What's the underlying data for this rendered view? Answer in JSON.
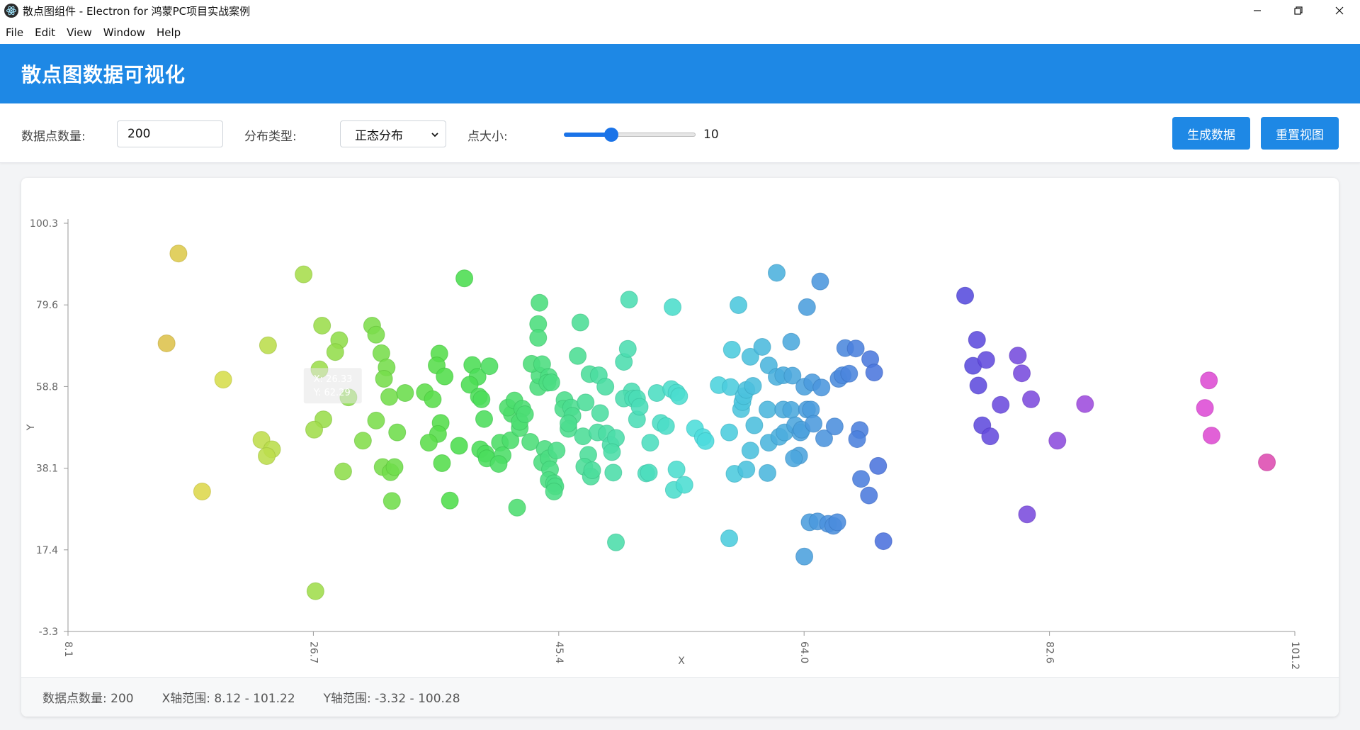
{
  "window": {
    "title": "散点图组件 - Electron for 鸿蒙PC项目实战案例"
  },
  "menu": [
    "File",
    "Edit",
    "View",
    "Window",
    "Help"
  ],
  "header": {
    "title": "散点图数据可视化"
  },
  "controls": {
    "count_label": "数据点数量:",
    "count_value": "200",
    "dist_label": "分布类型:",
    "dist_value": "正态分布",
    "size_label": "点大小:",
    "size_value": "10",
    "size_fraction": 0.36,
    "generate_button": "生成数据",
    "reset_button": "重置视图"
  },
  "stats": {
    "count": "数据点数量: 200",
    "x_range": "X轴范围: 8.12 - 101.22",
    "y_range": "Y轴范围: -3.32 - 100.28"
  },
  "tooltip": {
    "x": "X: 26.33",
    "y": "Y: 62.29"
  },
  "chart_data": {
    "type": "scatter",
    "xlabel": "X",
    "ylabel": "Y",
    "xlim": [
      8.12,
      101.22
    ],
    "ylim": [
      -3.32,
      100.28
    ],
    "xticks": [
      "8.1",
      "26.7",
      "45.4",
      "64.0",
      "82.6",
      "101.2"
    ],
    "xtick_values": [
      8.12,
      26.74,
      45.36,
      63.98,
      82.6,
      101.22
    ],
    "yticks": [
      "100.3",
      "79.6",
      "58.8",
      "38.1",
      "17.4",
      "-3.3"
    ],
    "ytick_values": [
      100.28,
      79.56,
      58.84,
      38.12,
      17.4,
      -3.32
    ],
    "grid": false,
    "point_color_scale": "hue by x: orange (low x) -> green -> cyan -> blue -> purple -> pink (high x)",
    "points": [
      [
        16.5,
        92.6
      ],
      [
        15.6,
        69.8
      ],
      [
        19.9,
        60.6
      ],
      [
        18.3,
        32.2
      ],
      [
        23.3,
        69.3
      ],
      [
        22.8,
        45.3
      ],
      [
        23.6,
        42.9
      ],
      [
        23.2,
        41.2
      ],
      [
        26.0,
        87.3
      ],
      [
        27.4,
        74.3
      ],
      [
        27.2,
        63.2
      ],
      [
        28.7,
        70.6
      ],
      [
        28.4,
        67.6
      ],
      [
        27.5,
        50.5
      ],
      [
        26.8,
        47.9
      ],
      [
        26.9,
        6.9
      ],
      [
        29.4,
        56.1
      ],
      [
        29.0,
        37.3
      ],
      [
        30.5,
        45.1
      ],
      [
        31.2,
        74.3
      ],
      [
        31.5,
        72.0
      ],
      [
        31.9,
        67.3
      ],
      [
        32.3,
        63.7
      ],
      [
        32.1,
        60.8
      ],
      [
        32.5,
        56.2
      ],
      [
        31.5,
        50.2
      ],
      [
        32.0,
        38.4
      ],
      [
        32.6,
        37.1
      ],
      [
        32.9,
        38.4
      ],
      [
        32.7,
        29.8
      ],
      [
        33.1,
        47.2
      ],
      [
        33.7,
        57.2
      ],
      [
        35.2,
        57.4
      ],
      [
        35.8,
        55.6
      ],
      [
        36.3,
        67.2
      ],
      [
        36.1,
        64.2
      ],
      [
        36.7,
        61.4
      ],
      [
        36.4,
        49.6
      ],
      [
        36.2,
        46.8
      ],
      [
        36.5,
        39.4
      ],
      [
        35.5,
        44.6
      ],
      [
        37.1,
        29.9
      ],
      [
        37.8,
        43.8
      ],
      [
        38.8,
        64.3
      ],
      [
        39.2,
        61.3
      ],
      [
        38.6,
        59.3
      ],
      [
        39.3,
        56.3
      ],
      [
        39.5,
        55.6
      ],
      [
        39.7,
        50.6
      ],
      [
        39.4,
        42.9
      ],
      [
        39.8,
        41.8
      ],
      [
        39.9,
        40.6
      ],
      [
        38.2,
        86.3
      ],
      [
        40.1,
        64.0
      ],
      [
        40.9,
        44.6
      ],
      [
        41.1,
        41.4
      ],
      [
        40.8,
        39.2
      ],
      [
        41.7,
        45.2
      ],
      [
        41.8,
        51.9
      ],
      [
        41.5,
        53.5
      ],
      [
        42.0,
        55.3
      ],
      [
        42.6,
        53.2
      ],
      [
        42.4,
        48.3
      ],
      [
        42.4,
        49.9
      ],
      [
        42.8,
        51.8
      ],
      [
        42.2,
        28.1
      ],
      [
        43.2,
        44.8
      ],
      [
        43.8,
        58.7
      ],
      [
        43.9,
        61.6
      ],
      [
        43.3,
        64.6
      ],
      [
        43.8,
        74.7
      ],
      [
        43.8,
        71.2
      ],
      [
        43.9,
        80.1
      ],
      [
        44.1,
        64.5
      ],
      [
        44.6,
        61.3
      ],
      [
        44.5,
        59.8
      ],
      [
        44.8,
        59.9
      ],
      [
        44.3,
        43.0
      ],
      [
        44.1,
        39.6
      ],
      [
        44.6,
        40.6
      ],
      [
        44.7,
        37.8
      ],
      [
        44.6,
        35.1
      ],
      [
        45.0,
        34.3
      ],
      [
        45.1,
        33.5
      ],
      [
        45.0,
        32.2
      ],
      [
        45.2,
        42.6
      ],
      [
        45.8,
        55.4
      ],
      [
        45.7,
        53.2
      ],
      [
        46.3,
        53.5
      ],
      [
        46.4,
        51.4
      ],
      [
        46.1,
        48.1
      ],
      [
        46.1,
        49.5
      ],
      [
        46.8,
        66.6
      ],
      [
        47.0,
        75.1
      ],
      [
        47.7,
        62.0
      ],
      [
        47.4,
        54.8
      ],
      [
        47.2,
        46.2
      ],
      [
        47.6,
        41.5
      ],
      [
        47.3,
        38.5
      ],
      [
        47.8,
        36.0
      ],
      [
        47.9,
        37.6
      ],
      [
        48.4,
        61.7
      ],
      [
        48.9,
        58.8
      ],
      [
        48.5,
        52.1
      ],
      [
        48.3,
        47.2
      ],
      [
        49.0,
        46.9
      ],
      [
        49.3,
        44.0
      ],
      [
        49.7,
        45.8
      ],
      [
        49.4,
        42.2
      ],
      [
        49.5,
        37.0
      ],
      [
        49.7,
        19.3
      ],
      [
        50.3,
        65.1
      ],
      [
        50.6,
        68.4
      ],
      [
        50.9,
        57.6
      ],
      [
        50.3,
        55.8
      ],
      [
        51.0,
        55.8
      ],
      [
        50.7,
        80.9
      ],
      [
        51.3,
        55.8
      ],
      [
        51.3,
        50.5
      ],
      [
        51.5,
        53.7
      ],
      [
        52.0,
        36.8
      ],
      [
        52.2,
        37.0
      ],
      [
        52.3,
        44.6
      ],
      [
        52.8,
        57.2
      ],
      [
        53.1,
        49.6
      ],
      [
        53.5,
        48.8
      ],
      [
        53.9,
        58.2
      ],
      [
        54.0,
        79.0
      ],
      [
        54.3,
        57.3
      ],
      [
        54.5,
        56.4
      ],
      [
        54.1,
        32.6
      ],
      [
        54.3,
        37.8
      ],
      [
        54.9,
        33.9
      ],
      [
        55.7,
        48.2
      ],
      [
        56.3,
        46.0
      ],
      [
        56.5,
        45.0
      ],
      [
        57.5,
        59.2
      ],
      [
        58.4,
        58.7
      ],
      [
        58.3,
        47.2
      ],
      [
        58.3,
        20.3
      ],
      [
        58.7,
        36.7
      ],
      [
        58.5,
        68.2
      ],
      [
        59.0,
        79.5
      ],
      [
        59.2,
        53.1
      ],
      [
        59.3,
        54.9
      ],
      [
        59.4,
        56.4
      ],
      [
        59.9,
        66.4
      ],
      [
        59.6,
        58.0
      ],
      [
        60.1,
        59.0
      ],
      [
        59.9,
        42.6
      ],
      [
        59.6,
        37.8
      ],
      [
        60.2,
        49.0
      ],
      [
        60.8,
        68.9
      ],
      [
        61.2,
        53.0
      ],
      [
        61.3,
        44.6
      ],
      [
        61.2,
        36.9
      ],
      [
        61.9,
        87.7
      ],
      [
        61.3,
        64.2
      ],
      [
        61.9,
        61.3
      ],
      [
        62.4,
        61.7
      ],
      [
        62.1,
        46.1
      ],
      [
        62.4,
        53.0
      ],
      [
        62.5,
        47.2
      ],
      [
        63.0,
        70.2
      ],
      [
        63.0,
        52.9
      ],
      [
        63.6,
        41.3
      ],
      [
        63.2,
        40.6
      ],
      [
        63.1,
        61.6
      ],
      [
        63.3,
        49.0
      ],
      [
        63.7,
        47.2
      ],
      [
        63.8,
        47.9
      ],
      [
        64.2,
        53.0
      ],
      [
        64.2,
        79.0
      ],
      [
        64.0,
        58.8
      ],
      [
        64.6,
        59.9
      ],
      [
        64.5,
        53.0
      ],
      [
        64.7,
        49.4
      ],
      [
        64.4,
        24.4
      ],
      [
        64.0,
        15.7
      ],
      [
        65.0,
        24.6
      ],
      [
        65.2,
        85.5
      ],
      [
        65.3,
        58.6
      ],
      [
        65.5,
        45.7
      ],
      [
        65.8,
        24.0
      ],
      [
        66.2,
        23.5
      ],
      [
        66.5,
        24.4
      ],
      [
        66.3,
        48.7
      ],
      [
        66.6,
        60.8
      ],
      [
        66.9,
        61.7
      ],
      [
        67.1,
        68.6
      ],
      [
        67.4,
        62.1
      ],
      [
        67.9,
        68.5
      ],
      [
        68.2,
        47.8
      ],
      [
        68.0,
        45.5
      ],
      [
        68.3,
        35.4
      ],
      [
        69.0,
        65.8
      ],
      [
        69.3,
        62.4
      ],
      [
        68.9,
        31.2
      ],
      [
        69.6,
        38.7
      ],
      [
        70.0,
        19.6
      ],
      [
        76.2,
        81.9
      ],
      [
        77.1,
        70.7
      ],
      [
        76.8,
        64.1
      ],
      [
        77.2,
        59.1
      ],
      [
        77.5,
        49.0
      ],
      [
        78.1,
        46.2
      ],
      [
        77.8,
        65.6
      ],
      [
        78.9,
        54.2
      ],
      [
        80.2,
        66.7
      ],
      [
        80.5,
        62.2
      ],
      [
        80.9,
        26.4
      ],
      [
        81.2,
        55.6
      ],
      [
        83.2,
        45.1
      ],
      [
        85.3,
        54.4
      ],
      [
        94.7,
        60.4
      ],
      [
        94.4,
        53.4
      ],
      [
        94.9,
        46.4
      ],
      [
        99.1,
        39.6
      ]
    ]
  }
}
